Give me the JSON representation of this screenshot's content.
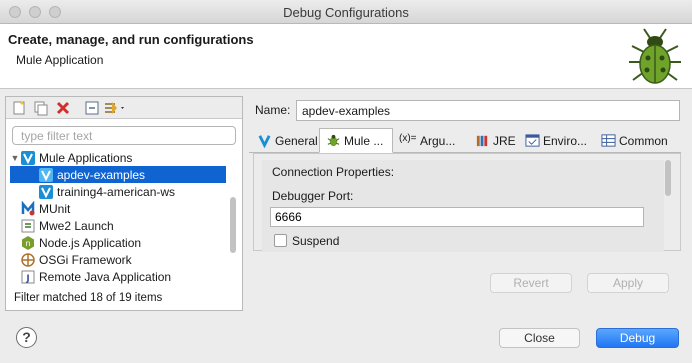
{
  "window": {
    "title": "Debug Configurations"
  },
  "banner": {
    "title": "Create, manage, and run configurations",
    "subtitle": "Mule Application",
    "icon": "debug-bug-icon"
  },
  "left_panel": {
    "toolbar_icons": [
      "new-configuration-icon",
      "duplicate-icon",
      "delete-icon",
      "collapse-all-icon",
      "filter-icon"
    ],
    "filter_placeholder": "type filter text",
    "tree": [
      {
        "label": "Mule Applications",
        "icon": "mule-icon",
        "expanded": true,
        "level": 0
      },
      {
        "label": "apdev-examples",
        "icon": "mule-icon",
        "level": 1,
        "selected": true
      },
      {
        "label": "training4-american-ws",
        "icon": "mule-icon",
        "level": 1
      },
      {
        "label": "MUnit",
        "icon": "munit-icon",
        "level": 0
      },
      {
        "label": "Mwe2 Launch",
        "icon": "mwe2-icon",
        "level": 0
      },
      {
        "label": "Node.js Application",
        "icon": "nodejs-icon",
        "level": 0
      },
      {
        "label": "OSGi Framework",
        "icon": "osgi-icon",
        "level": 0
      },
      {
        "label": "Remote Java Application",
        "icon": "remote-java-icon",
        "level": 0
      }
    ],
    "status": "Filter matched 18 of 19 items"
  },
  "name_field": {
    "label": "Name:",
    "value": "apdev-examples"
  },
  "tabs": [
    {
      "label": "General",
      "icon": "mule-icon"
    },
    {
      "label": "Mule ...",
      "icon": "debug-bug-icon",
      "active": true
    },
    {
      "label": "Argu...",
      "icon": "variable-icon"
    },
    {
      "label": "JRE",
      "icon": "library-icon"
    },
    {
      "label": "Enviro...",
      "icon": "environment-icon"
    },
    {
      "label": "Common",
      "icon": "common-icon"
    }
  ],
  "connection": {
    "group_title": "Connection Properties:",
    "port_label": "Debugger Port:",
    "port_value": "6666",
    "suspend_label": "Suspend",
    "suspend_checked": false
  },
  "buttons": {
    "revert": "Revert",
    "apply": "Apply",
    "close": "Close",
    "debug": "Debug",
    "help": "?"
  },
  "colors": {
    "selection": "#0f64d2",
    "primary_button": "#2176f2"
  }
}
